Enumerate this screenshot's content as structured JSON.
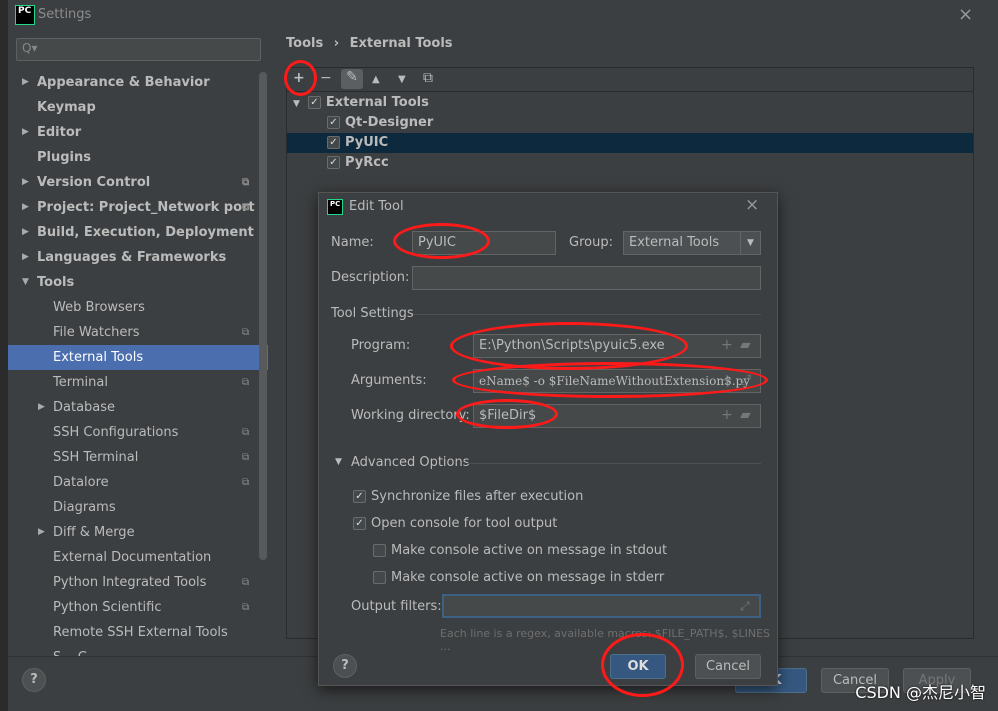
{
  "window": {
    "title": "Settings",
    "logo": "PC",
    "close_icon": "×"
  },
  "search": {
    "placeholder": "Q▾"
  },
  "sidebar": {
    "items": [
      {
        "label": "Appearance & Behavior",
        "bold": true,
        "arrow": "▶"
      },
      {
        "label": "Keymap",
        "bold": true
      },
      {
        "label": "Editor",
        "bold": true,
        "arrow": "▶"
      },
      {
        "label": "Plugins",
        "bold": true
      },
      {
        "label": "Version Control",
        "bold": true,
        "arrow": "▶",
        "copy": true
      },
      {
        "label": "Project: Project_Network port",
        "bold": true,
        "arrow": "▶",
        "copy": true
      },
      {
        "label": "Build, Execution, Deployment",
        "bold": true,
        "arrow": "▶"
      },
      {
        "label": "Languages & Frameworks",
        "bold": true,
        "arrow": "▶"
      },
      {
        "label": "Tools",
        "bold": true,
        "arrow": "▼"
      },
      {
        "label": "Web Browsers"
      },
      {
        "label": "File Watchers",
        "copy": true
      },
      {
        "label": "External Tools",
        "selected": true
      },
      {
        "label": "Terminal",
        "copy": true
      },
      {
        "label": "Database",
        "arrow": "▶"
      },
      {
        "label": "SSH Configurations",
        "copy": true
      },
      {
        "label": "SSH Terminal",
        "copy": true
      },
      {
        "label": "Datalore",
        "copy": true
      },
      {
        "label": "Diagrams"
      },
      {
        "label": "Diff & Merge",
        "arrow": "▶"
      },
      {
        "label": "External Documentation"
      },
      {
        "label": "Python Integrated Tools",
        "copy": true
      },
      {
        "label": "Python Scientific",
        "copy": true
      },
      {
        "label": "Remote SSH External Tools"
      },
      {
        "label": "S... C..."
      }
    ]
  },
  "breadcrumb": {
    "parent": "Tools",
    "sep": "›",
    "current": "External Tools"
  },
  "toolbar": {
    "add": "+",
    "remove": "−",
    "edit": "✎",
    "up": "▲",
    "down": "▼",
    "copy": "⧉"
  },
  "tree": [
    {
      "label": "External Tools",
      "arrow": "▼",
      "checked": true
    },
    {
      "label": "Qt-Designer",
      "checked": true
    },
    {
      "label": "PyUIC",
      "checked": true,
      "selected": true
    },
    {
      "label": "PyRcc",
      "checked": true
    }
  ],
  "dialog": {
    "title": "Edit Tool",
    "logo": "PC",
    "close": "×",
    "name_label": "Name:",
    "name_value": "PyUIC",
    "group_label": "Group:",
    "group_value": "External Tools",
    "description_label": "Description:",
    "description_value": "",
    "tool_settings": "Tool Settings",
    "program_label": "Program:",
    "program_value": "E:\\Python\\Scripts\\pyuic5.exe",
    "arguments_label": "Arguments:",
    "arguments_value": "eName$ -o $FileNameWithoutExtension$.py",
    "workdir_label": "Working directory:",
    "workdir_value": "$FileDir$",
    "advanced": "Advanced Options",
    "options": [
      {
        "label": "Synchronize files after execution",
        "checked": true
      },
      {
        "label": "Open console for tool output",
        "checked": true
      },
      {
        "label": "Make console active on message in stdout",
        "checked": false
      },
      {
        "label": "Make console active on message in stderr",
        "checked": false
      }
    ],
    "output_filters_label": "Output filters:",
    "output_filters_value": "",
    "hint": "Each line is a regex, available macros: $FILE_PATH$, $LINES ...",
    "help": "?",
    "ok": "OK",
    "cancel": "Cancel"
  },
  "footer": {
    "help": "?",
    "ok": "OK",
    "cancel": "Cancel",
    "apply": "Apply"
  },
  "watermark": "CSDN @杰尼小智",
  "colors": {
    "selection": "#4b6eaf",
    "annotation": "#ff1a1a",
    "ok": "#365880"
  }
}
